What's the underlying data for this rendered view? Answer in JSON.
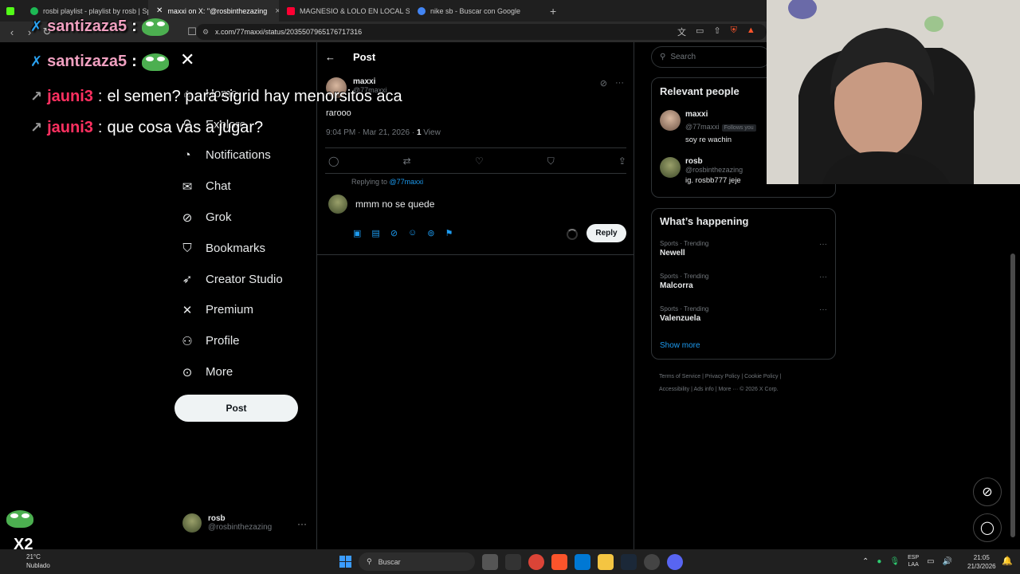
{
  "browser": {
    "tabs": [
      {
        "title": "rosbi playlist - playlist by rosb | Spoti",
        "color": "#1db954"
      },
      {
        "title": "maxxi on X: \"@rosbinthezazing",
        "color": "#ffffff",
        "active": true
      },
      {
        "title": "MAGNESIO & LOLO EN LOCAL SUP",
        "color": "#ff0033"
      },
      {
        "title": "nike sb - Buscar con Google",
        "color": "#4285f4"
      }
    ],
    "url": "x.com/77maxxi/status/2035507965176717316"
  },
  "chat_overlay": {
    "lines": [
      {
        "user": "santizaza5",
        "message": ""
      },
      {
        "user": "santizaza5",
        "message": ""
      },
      {
        "user": "jauni3",
        "message": "el semen? para sigrid hay menorsitos aca"
      },
      {
        "user": "jauni3",
        "message": "que cosa vas a jugar?"
      }
    ],
    "x2": "X2"
  },
  "sidebar": {
    "items": [
      {
        "label": "Home",
        "icon": "home-icon",
        "glyph": "⌂"
      },
      {
        "label": "Explore",
        "icon": "search-icon",
        "glyph": "⚲"
      },
      {
        "label": "Notifications",
        "icon": "bell-icon",
        "glyph": "🔔"
      },
      {
        "label": "Chat",
        "icon": "mail-icon",
        "glyph": "✉"
      },
      {
        "label": "Grok",
        "icon": "grok-icon",
        "glyph": "⊘"
      },
      {
        "label": "Bookmarks",
        "icon": "bookmark-icon",
        "glyph": "🔖"
      },
      {
        "label": "Creator Studio",
        "icon": "rocket-icon",
        "glyph": "🚀"
      },
      {
        "label": "Premium",
        "icon": "x-icon",
        "glyph": "✕"
      },
      {
        "label": "Profile",
        "icon": "person-icon",
        "glyph": "👤"
      },
      {
        "label": "More",
        "icon": "more-circle-icon",
        "glyph": "⋯"
      }
    ],
    "post_label": "Post",
    "account": {
      "name": "rosb",
      "handle": "@rosbinthezazing"
    }
  },
  "post": {
    "header": "Post",
    "author_name": "maxxi",
    "author_handle": "@77maxxi",
    "text": "rarooo",
    "time": "9:04 PM · Mar 21, 2026 · ",
    "views_count": "1",
    "views_label": " View",
    "replying_prefix": "Replying to ",
    "replying_to": "@77maxxi",
    "compose_value": "mmm no se quede",
    "reply_label": "Reply"
  },
  "right": {
    "search_placeholder": "Search",
    "relevant_title": "Relevant people",
    "people": [
      {
        "name": "maxxi",
        "handle": "@77maxxi",
        "follows": "Follows you",
        "bio": "soy re wachin"
      },
      {
        "name": "rosb",
        "handle": "@rosbinthezazing",
        "follows": "",
        "bio": "ig. rosbb777 jeje"
      }
    ],
    "happening_title": "What’s happening",
    "trends": [
      {
        "category": "Sports · Trending",
        "name": "Newell"
      },
      {
        "category": "Sports · Trending",
        "name": "Malcorra"
      },
      {
        "category": "Sports · Trending",
        "name": "Valenzuela"
      }
    ],
    "show_more": "Show more",
    "footer_line1": "Terms of Service  |  Privacy Policy  |  Cookie Policy  |",
    "footer_line2": "Accessibility  |  Ads info  |  More ···  © 2026 X Corp."
  },
  "taskbar": {
    "temp": "21°C",
    "weather": "Nublado",
    "search": "Buscar",
    "lang1": "ESP",
    "lang2": "LAA",
    "time": "21:05",
    "date": "21/3/2026"
  }
}
